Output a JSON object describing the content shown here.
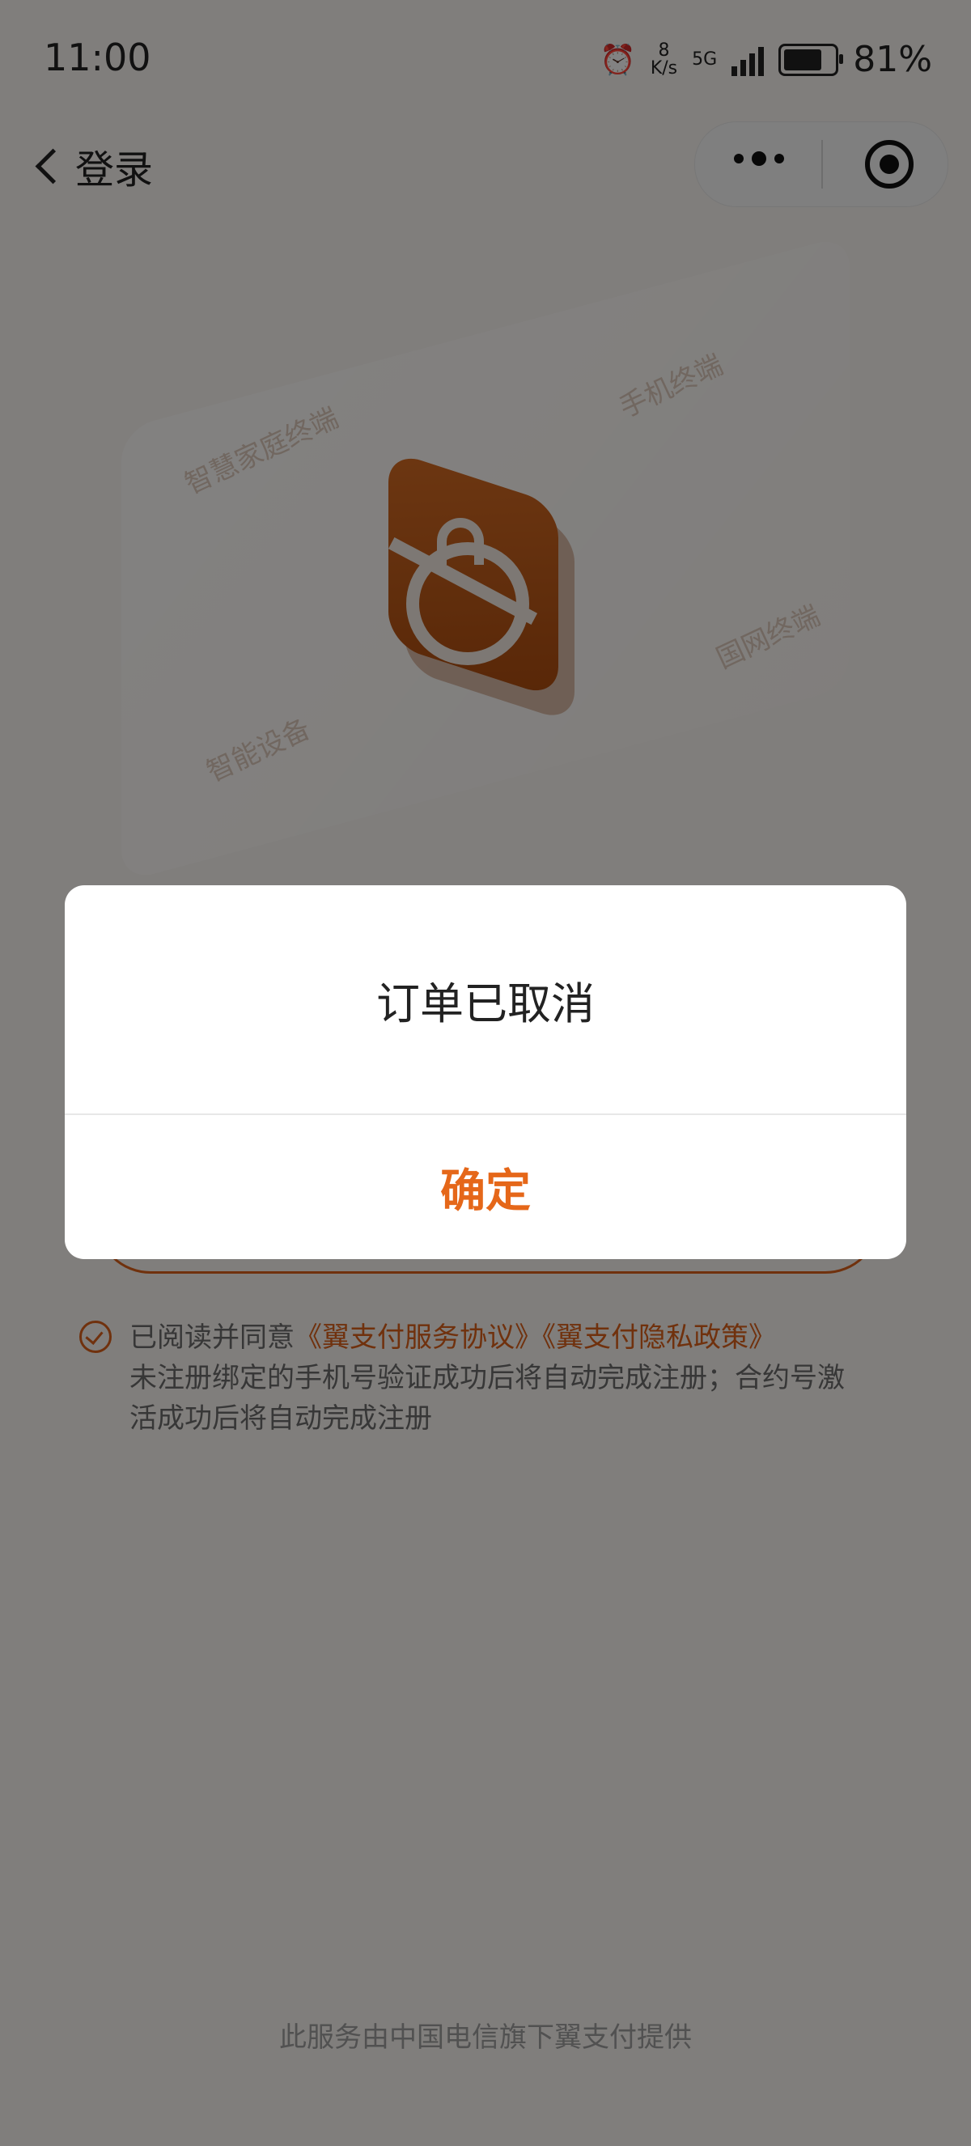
{
  "status": {
    "time": "11:00",
    "speed_value": "8",
    "speed_unit": "K/s",
    "network": "5G",
    "battery": "81%"
  },
  "nav": {
    "back_label": "登录"
  },
  "hero": {
    "labels": [
      "智慧家庭终端",
      "手机终端",
      "国网终端",
      "智能设备"
    ]
  },
  "agreement": {
    "prefix": "已阅读并同意",
    "link1": "《翼支付服务协议》",
    "link2": "《翼支付隐私政策》",
    "note": "未注册绑定的手机号验证成功后将自动完成注册；合约号激活成功后将自动完成注册"
  },
  "footer": {
    "text": "此服务由中国电信旗下翼支付提供"
  },
  "dialog": {
    "message": "订单已取消",
    "confirm_label": "确定"
  },
  "colors": {
    "accent": "#e56719",
    "overlay": "rgba(0,0,0,0.48)"
  }
}
